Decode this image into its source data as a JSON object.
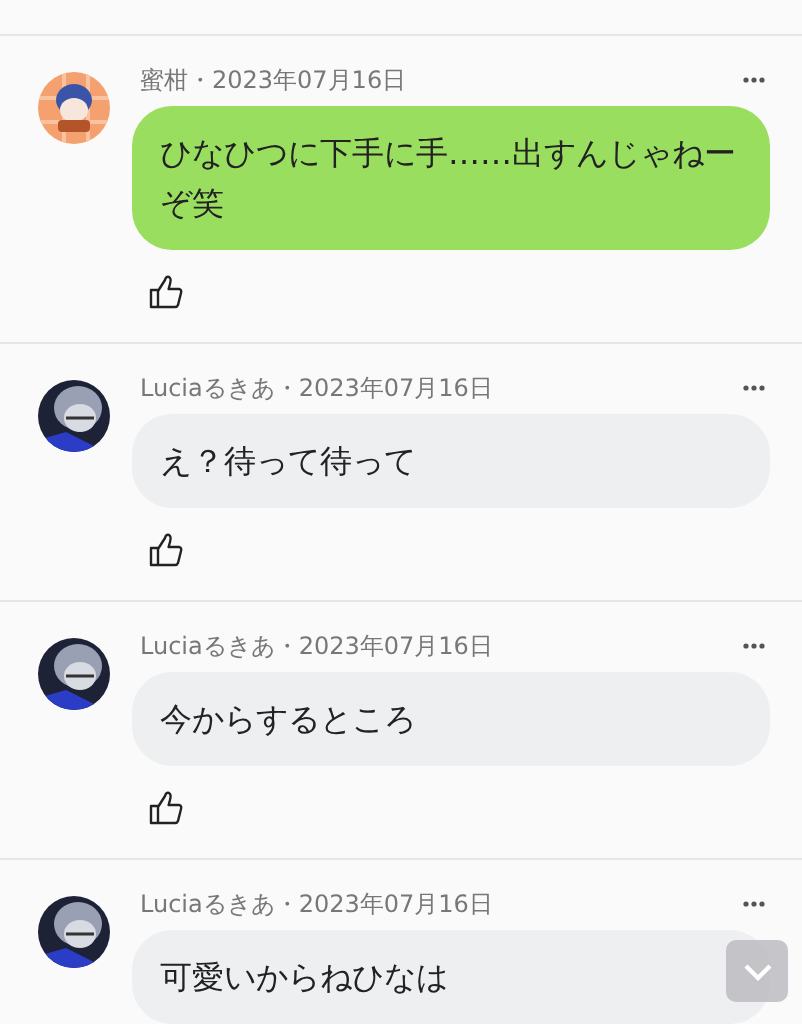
{
  "posts": [
    {
      "header": "蜜柑・2023年07月16日",
      "kind": "green",
      "message": "ひなひつに下手に手……出すんじゃねーぞ笑"
    },
    {
      "header": "Luciaるきあ・2023年07月16日",
      "kind": "gray",
      "message": "え？待って待って"
    },
    {
      "header": "Luciaるきあ・2023年07月16日",
      "kind": "gray",
      "message": "今からするところ"
    },
    {
      "header": "Luciaるきあ・2023年07月16日",
      "kind": "gray",
      "message": "可愛いからねひなは"
    }
  ]
}
